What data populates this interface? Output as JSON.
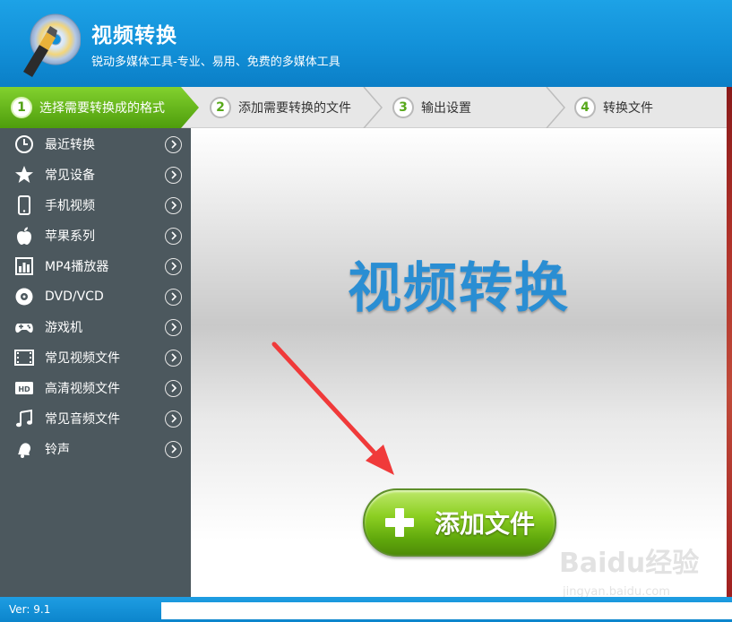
{
  "header": {
    "title": "视频转换",
    "subtitle": "锐动多媒体工具-专业、易用、免费的多媒体工具",
    "logo_icon": "disc-pen-icon"
  },
  "steps": [
    {
      "num": "1",
      "label": "选择需要转换成的格式",
      "active": true
    },
    {
      "num": "2",
      "label": "添加需要转换的文件",
      "active": false
    },
    {
      "num": "3",
      "label": "输出设置",
      "active": false
    },
    {
      "num": "4",
      "label": "转换文件",
      "active": false
    }
  ],
  "sidebar": {
    "items": [
      {
        "label": "最近转换",
        "icon": "clock-icon"
      },
      {
        "label": "常见设备",
        "icon": "star-icon"
      },
      {
        "label": "手机视频",
        "icon": "phone-icon"
      },
      {
        "label": "苹果系列",
        "icon": "apple-icon"
      },
      {
        "label": "MP4播放器",
        "icon": "mp4-player-icon"
      },
      {
        "label": "DVD/VCD",
        "icon": "disc-icon"
      },
      {
        "label": "游戏机",
        "icon": "gamepad-icon"
      },
      {
        "label": "常见视频文件",
        "icon": "film-icon"
      },
      {
        "label": "高清视频文件",
        "icon": "hd-icon"
      },
      {
        "label": "常见音频文件",
        "icon": "music-note-icon"
      },
      {
        "label": "铃声",
        "icon": "bell-icon"
      }
    ]
  },
  "main": {
    "title": "视频转换",
    "add_button": "添加文件"
  },
  "status": {
    "version": "Ver: 9.1"
  },
  "watermark": {
    "text": "Baidu经验",
    "url": "jingyan.baidu.com"
  },
  "colors": {
    "header_blue": "#1290d8",
    "sidebar": "#4c585e",
    "step_active": "#5cb012",
    "title_blue": "#2a8ed3",
    "arrow_red": "#f03a3a"
  }
}
